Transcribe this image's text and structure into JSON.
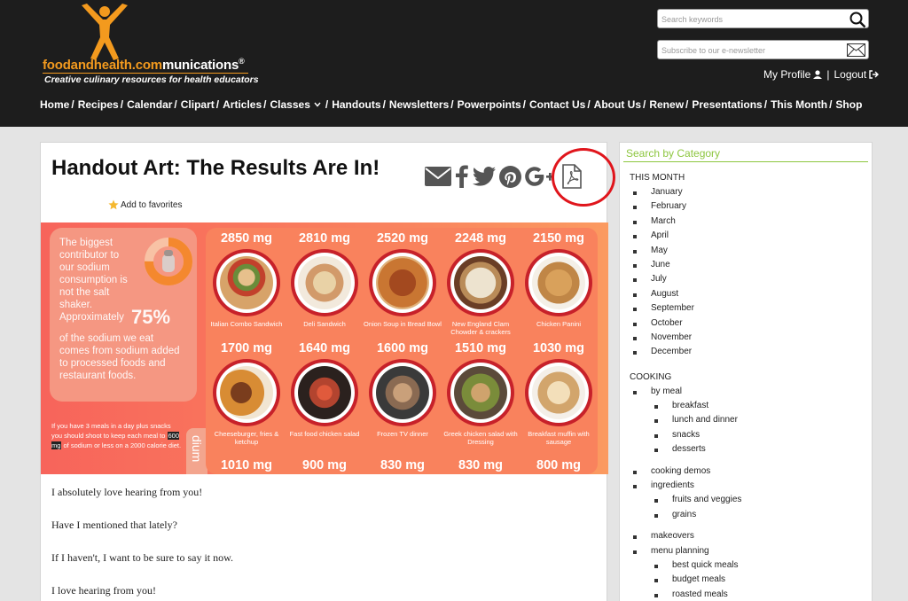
{
  "logo": {
    "brand_part1": "foodandhealth.com",
    "brand_part2": "munications",
    "registered": "®",
    "tagline": "Creative culinary resources for health educators"
  },
  "search": {
    "placeholder": "Search keywords"
  },
  "newsletter": {
    "placeholder": "Subscribe to our e-newsletter"
  },
  "account": {
    "profile": "My Profile",
    "separator": "|",
    "logout": "Logout"
  },
  "nav": [
    "Home",
    "Recipes",
    "Calendar",
    "Clipart",
    "Articles",
    "Classes",
    "Handouts",
    "Newsletters",
    "Powerpoints",
    "Contact Us",
    "About Us",
    "Renew",
    "Presentations",
    "This Month",
    "Shop"
  ],
  "nav_slash": "/",
  "article": {
    "title": "Handout Art: The Results Are In!",
    "favorites": "Add to favorites",
    "paragraphs": [
      "I absolutely love hearing from you!",
      "Have I mentioned that lately?",
      "If I haven't, I want to be sure to say it now.",
      "I love hearing from you!"
    ]
  },
  "infographic": {
    "intro": "The biggest contributor to our sodium consumption is not the salt shaker. Approximately",
    "percent": "75%",
    "outro": "of the sodium we eat comes from sodium added to processed foods and restaurant foods.",
    "note_pre": "If you have 3 meals in a day plus snacks you should shoot to keep each meal to",
    "note_hl": "600 mg",
    "note_post": "of sodium or less on a 2000 calorie diet.",
    "side_word": "dium",
    "row1": [
      {
        "mg": "2850 mg",
        "label": "Italian Combo Sandwich"
      },
      {
        "mg": "2810 mg",
        "label": "Deli Sandwich"
      },
      {
        "mg": "2520 mg",
        "label": "Onion Soup in Bread Bowl"
      },
      {
        "mg": "2248 mg",
        "label": "New England Clam Chowder & crackers"
      },
      {
        "mg": "2150 mg",
        "label": "Chicken Panini"
      }
    ],
    "row2": [
      {
        "mg": "1700 mg",
        "label": "Cheeseburger, fries & ketchup"
      },
      {
        "mg": "1640 mg",
        "label": "Fast food chicken salad"
      },
      {
        "mg": "1600 mg",
        "label": "Frozen TV dinner"
      },
      {
        "mg": "1510 mg",
        "label": "Greek chicken salad with Dressing"
      },
      {
        "mg": "1030 mg",
        "label": "Breakfast muffin with sausage"
      }
    ],
    "row3": [
      "1010 mg",
      "900 mg",
      "830 mg",
      "830 mg",
      "800 mg"
    ]
  },
  "sidebar": {
    "heading": "Search by Category",
    "this_month_label": "THIS MONTH",
    "months": [
      "January",
      "February",
      "March",
      "April",
      "May",
      "June",
      "July",
      "August",
      "September",
      "October",
      "November",
      "December"
    ],
    "cooking_label": "COOKING",
    "by_meal": "by meal",
    "meals": [
      "breakfast",
      "lunch and dinner",
      "snacks",
      "desserts"
    ],
    "cooking_demos": "cooking demos",
    "ingredients": "ingredients",
    "ingredient_items": [
      "fruits and veggies",
      "grains"
    ],
    "makeovers": "makeovers",
    "menu_planning": "menu planning",
    "menu_items": [
      "best quick meals",
      "budget meals",
      "roasted meals"
    ]
  },
  "colors": {
    "header_bg": "#1d1d1d",
    "brand_orange": "#f39a1e",
    "sidebar_green": "#8dc63f",
    "pdf_highlight": "#e0151c",
    "plate_red": "#c7212a"
  },
  "icons": [
    "search-icon",
    "mail-icon",
    "user-icon",
    "logout-icon",
    "chevron-down-icon",
    "envelope-icon",
    "facebook-icon",
    "twitter-icon",
    "pinterest-icon",
    "google-plus-icon",
    "pdf-icon",
    "star-icon"
  ]
}
